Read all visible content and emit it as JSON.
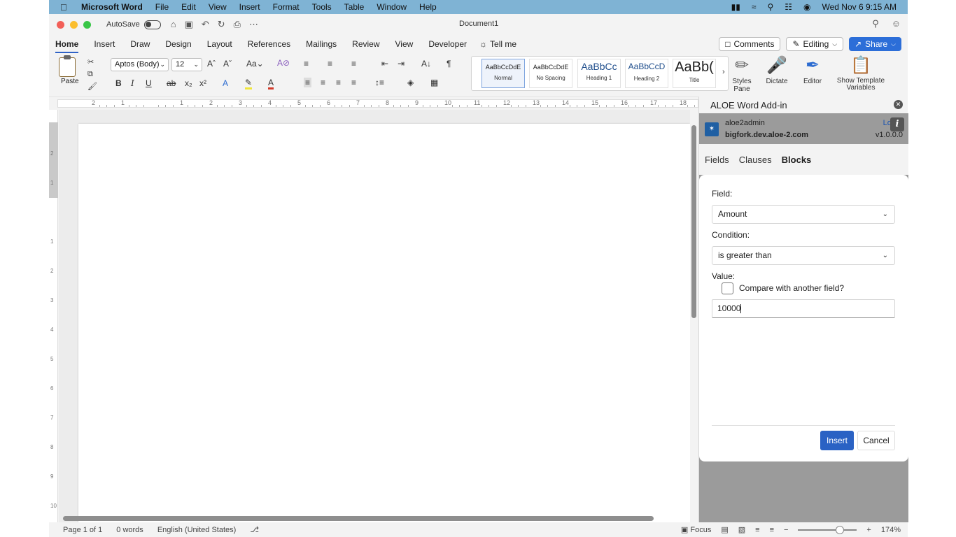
{
  "menubar": {
    "app_name": "Microsoft Word",
    "items": [
      "File",
      "Edit",
      "View",
      "Insert",
      "Format",
      "Tools",
      "Table",
      "Window",
      "Help"
    ],
    "clock": "Wed Nov 6  9:15 AM"
  },
  "titlebar": {
    "autosave_label": "AutoSave",
    "document_title": "Document1"
  },
  "ribbon_tabs": [
    "Home",
    "Insert",
    "Draw",
    "Design",
    "Layout",
    "References",
    "Mailings",
    "Review",
    "View",
    "Developer"
  ],
  "tell_me": "Tell me",
  "actions": {
    "comments": "Comments",
    "editing": "Editing",
    "share": "Share"
  },
  "ribbon": {
    "paste": "Paste",
    "font_name": "Aptos (Body)",
    "font_size": "12",
    "styles": [
      {
        "sample": "AaBbCcDdE",
        "name": "Normal"
      },
      {
        "sample": "AaBbCcDdE",
        "name": "No Spacing"
      },
      {
        "sample": "AaBbCc",
        "name": "Heading 1"
      },
      {
        "sample": "AaBbCcD",
        "name": "Heading 2"
      },
      {
        "sample": "AaBb(",
        "name": "Title"
      }
    ],
    "styles_pane": "Styles Pane",
    "dictate": "Dictate",
    "editor": "Editor",
    "show_template_variables": "Show Template Variables"
  },
  "ruler_numbers": [
    "2",
    "1",
    "",
    "1",
    "2",
    "3",
    "4",
    "5",
    "6",
    "7",
    "8",
    "9",
    "10",
    "11",
    "12",
    "13",
    "14",
    "15",
    "16",
    "17",
    "18"
  ],
  "status": {
    "page": "Page 1 of 1",
    "words": "0 words",
    "language": "English (United States)",
    "focus": "Focus",
    "zoom": "174%"
  },
  "addin": {
    "title": "ALOE Word Add-in",
    "user": "aloe2admin",
    "host": "bigfork.dev.aloe-2.com",
    "logout": "Log",
    "version": "v1.0.0.0",
    "tabs": [
      "Fields",
      "Clauses",
      "Blocks"
    ],
    "active_tab": "Blocks",
    "form": {
      "field_label": "Field:",
      "field_value": "Amount",
      "condition_label": "Condition:",
      "condition_value": "is greater than",
      "value_label": "Value:",
      "compare_label": "Compare with another field?",
      "value_input": "10000"
    },
    "insert_button": "Insert",
    "cancel_button": "Cancel"
  },
  "colors": {
    "menubar": "#7fb3d4",
    "accent": "#2a62c4",
    "share": "#2c6ed8",
    "pane_overlay": "#9b9b9b"
  }
}
